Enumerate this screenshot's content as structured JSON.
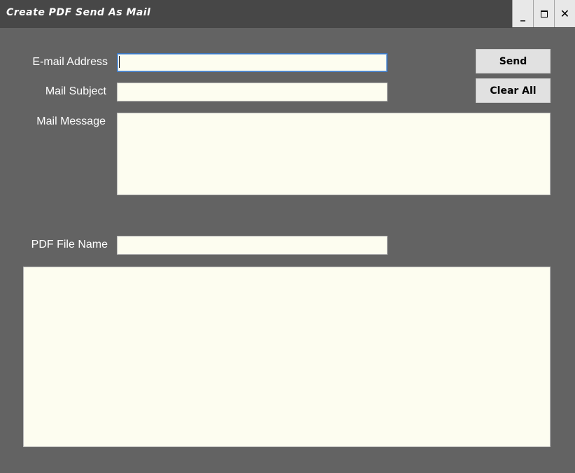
{
  "window": {
    "title": "Create PDF Send As Mail",
    "controls": {
      "minimize": "_",
      "close": "✕"
    }
  },
  "form": {
    "email": {
      "label": "E-mail Address",
      "value": ""
    },
    "subject": {
      "label": "Mail Subject",
      "value": ""
    },
    "message": {
      "label": "Mail Message",
      "value": ""
    },
    "pdf_file": {
      "label": "PDF File Name",
      "value": ""
    }
  },
  "buttons": {
    "send": "Send",
    "clear_all": "Clear All"
  },
  "colors": {
    "background": "#636363",
    "titlebar": "#474747",
    "field": "#fdfdf0",
    "button": "#e1e1e1"
  }
}
